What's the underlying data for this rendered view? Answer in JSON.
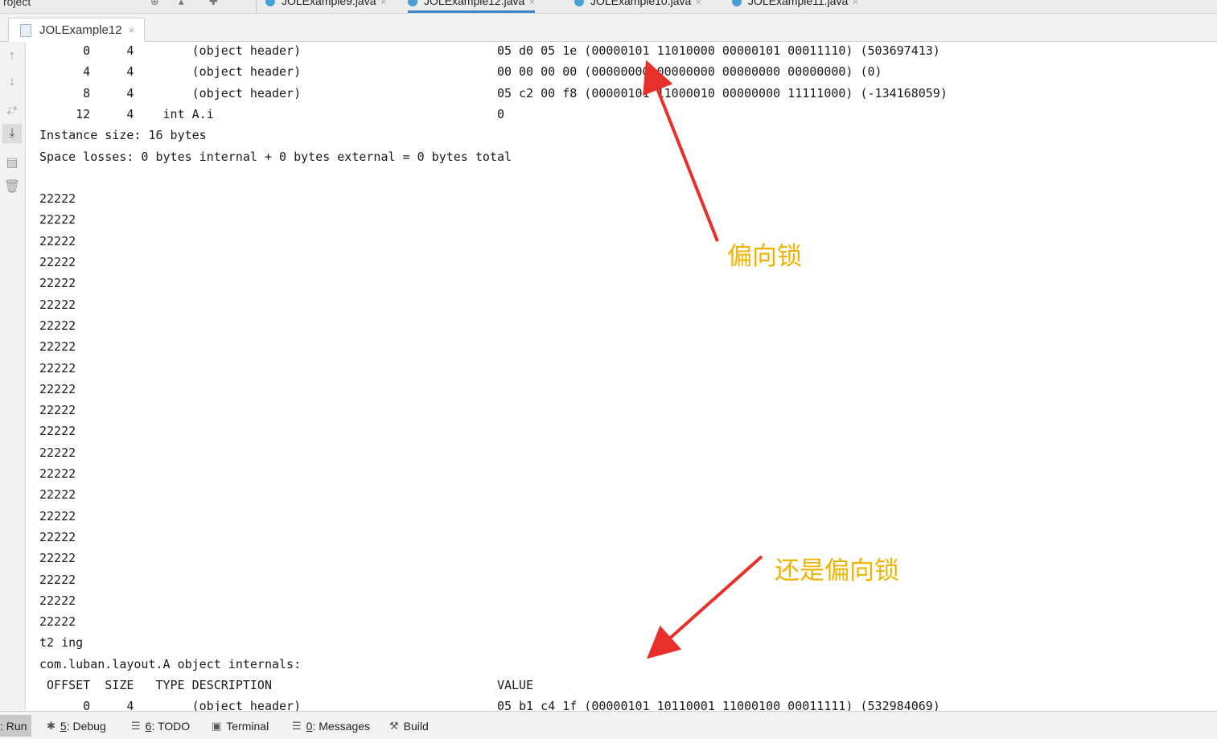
{
  "editor_tabs": {
    "project_label": "roject",
    "tabs": [
      {
        "label": "JOLExample9.java",
        "active": false
      },
      {
        "label": "JOLExample12.java",
        "active": true
      },
      {
        "label": "JOLExample10.java",
        "active": false
      },
      {
        "label": "JOLExample11.java",
        "active": false
      }
    ]
  },
  "run_tab": {
    "label": "JOLExample12",
    "close": "×"
  },
  "side_toolbar": {
    "icons": [
      "up-arrow-icon",
      "down-arrow-icon",
      "soft-wrap-icon",
      "scroll-to-end-icon",
      "print-icon",
      "trash-icon"
    ]
  },
  "console": {
    "lines": [
      "      0     4        (object header)                           05 d0 05 1e (00000101 11010000 00000101 00011110) (503697413)",
      "      4     4        (object header)                           00 00 00 00 (00000000 00000000 00000000 00000000) (0)",
      "      8     4        (object header)                           05 c2 00 f8 (00000101 11000010 00000000 11111000) (-134168059)",
      "     12     4    int A.i                                       0",
      "Instance size: 16 bytes",
      "Space losses: 0 bytes internal + 0 bytes external = 0 bytes total",
      "",
      "22222",
      "22222",
      "22222",
      "22222",
      "22222",
      "22222",
      "22222",
      "22222",
      "22222",
      "22222",
      "22222",
      "22222",
      "22222",
      "22222",
      "22222",
      "22222",
      "22222",
      "22222",
      "22222",
      "22222",
      "22222",
      "t2 ing",
      "com.luban.layout.A object internals:",
      " OFFSET  SIZE   TYPE DESCRIPTION                               VALUE",
      "      0     4        (object header)                           05 b1 c4 1f (00000101 10110001 11000100 00011111) (532984069)",
      "      4     4        (object header)                           00 00 00 00 (00000000 00000000 00000000 00000000) (0)"
    ]
  },
  "annotations": {
    "biased_lock": "偏向锁",
    "still_biased_lock": "还是偏向锁",
    "color": "#f0b400",
    "arrow_color": "#e8302a"
  },
  "bottom_bar": {
    "run": ": Run",
    "debug_key": "5",
    "debug": ": Debug",
    "todo_key": "6",
    "todo": ": TODO",
    "terminal": "Terminal",
    "messages_key": "0",
    "messages": ": Messages",
    "build": "Build"
  }
}
